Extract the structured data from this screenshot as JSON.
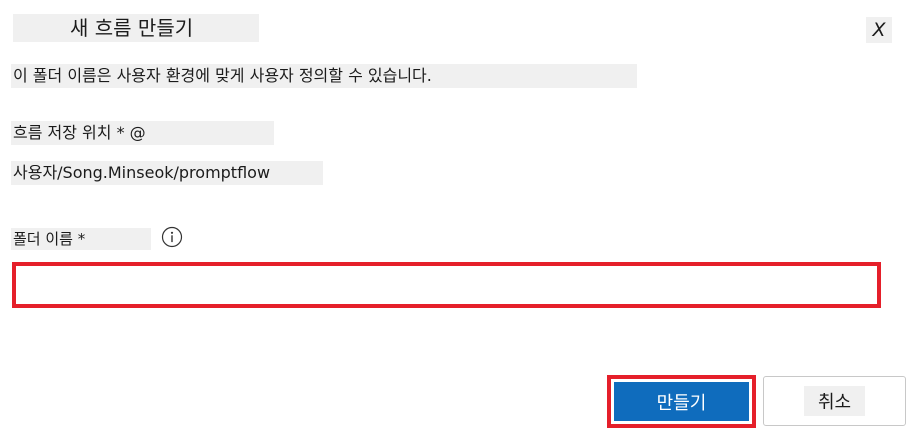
{
  "dialog": {
    "title": "새 흐름 만들기",
    "close_label": "X",
    "description": "이 폴더 이름은 사용자 환경에 맞게 사용자 정의할 수 있습니다."
  },
  "location": {
    "label": "흐름 저장 위치 * @",
    "value": "사용자/Song.Minseok/promptflow"
  },
  "folder_name": {
    "label": "폴더 이름 *",
    "value": "",
    "info_icon": "info-icon"
  },
  "buttons": {
    "create_label": "만들기",
    "cancel_label": "취소"
  },
  "colors": {
    "primary": "#0f6cbd",
    "highlight": "#e51f2a"
  }
}
